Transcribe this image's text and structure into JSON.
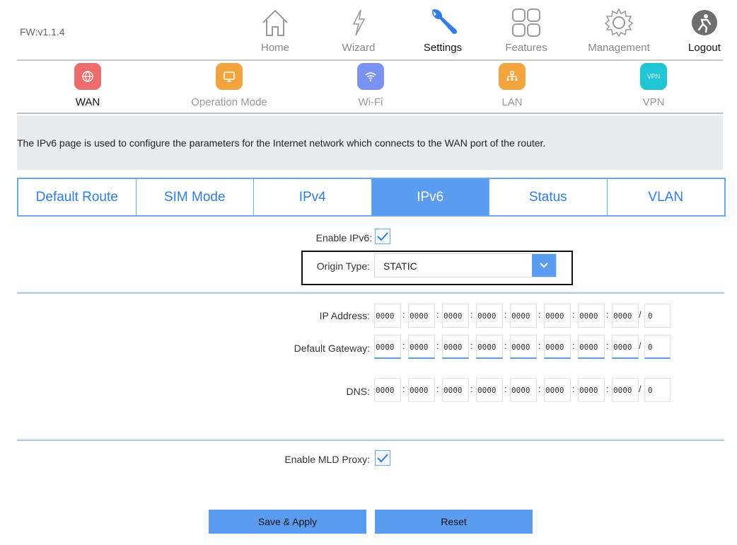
{
  "firmware": "FW:v1.1.4",
  "top_nav": [
    {
      "label": "Home",
      "icon": "home-icon"
    },
    {
      "label": "Wizard",
      "icon": "wizard-icon"
    },
    {
      "label": "Settings",
      "icon": "wrench-icon",
      "active": true
    },
    {
      "label": "Features",
      "icon": "grid-icon"
    },
    {
      "label": "Management",
      "icon": "gear-icon"
    },
    {
      "label": "Logout",
      "icon": "logout-icon"
    }
  ],
  "sub_nav": [
    {
      "label": "WAN",
      "icon": "globe-icon",
      "color": "#ec6b6b",
      "active": true
    },
    {
      "label": "Operation Mode",
      "icon": "monitor-icon",
      "color": "#f3a43d"
    },
    {
      "label": "Wi-Fi",
      "icon": "wifi-icon",
      "color": "#7b93f0"
    },
    {
      "label": "LAN",
      "icon": "lan-icon",
      "color": "#f3a43d"
    },
    {
      "label": "VPN",
      "icon": "vpn-icon",
      "badge_text": "VPN",
      "color": "#1fc6d4"
    }
  ],
  "info_text": "The IPv6 page is used to configure the parameters for the Internet network which connects to the WAN port of the router.",
  "tabs": [
    "Default Route",
    "SIM Mode",
    "IPv4",
    "IPv6",
    "Status",
    "VLAN"
  ],
  "active_tab": "IPv6",
  "form": {
    "enable_ipv6_label": "Enable IPv6:",
    "enable_ipv6_checked": true,
    "origin_type_label": "Origin Type:",
    "origin_type_value": "STATIC",
    "ip_address_label": "IP Address:",
    "ip_address": [
      "0000",
      "0000",
      "0000",
      "0000",
      "0000",
      "0000",
      "0000",
      "0000",
      "0"
    ],
    "default_gateway_label": "Default Gateway:",
    "default_gateway": [
      "0000",
      "0000",
      "0000",
      "0000",
      "0000",
      "0000",
      "0000",
      "0000",
      "0"
    ],
    "dns_label": "DNS:",
    "dns": [
      "0000",
      "0000",
      "0000",
      "0000",
      "0000",
      "0000",
      "0000",
      "0000",
      "0"
    ],
    "separator": ":",
    "prefix_separator": "/",
    "enable_mld_label": "Enable MLD Proxy:",
    "enable_mld_checked": true
  },
  "buttons": {
    "save": "Save & Apply",
    "reset": "Reset"
  },
  "colors": {
    "accent": "#5a9cf0",
    "tab_border": "#6aa6ec",
    "info_bg": "#e9ecee"
  }
}
